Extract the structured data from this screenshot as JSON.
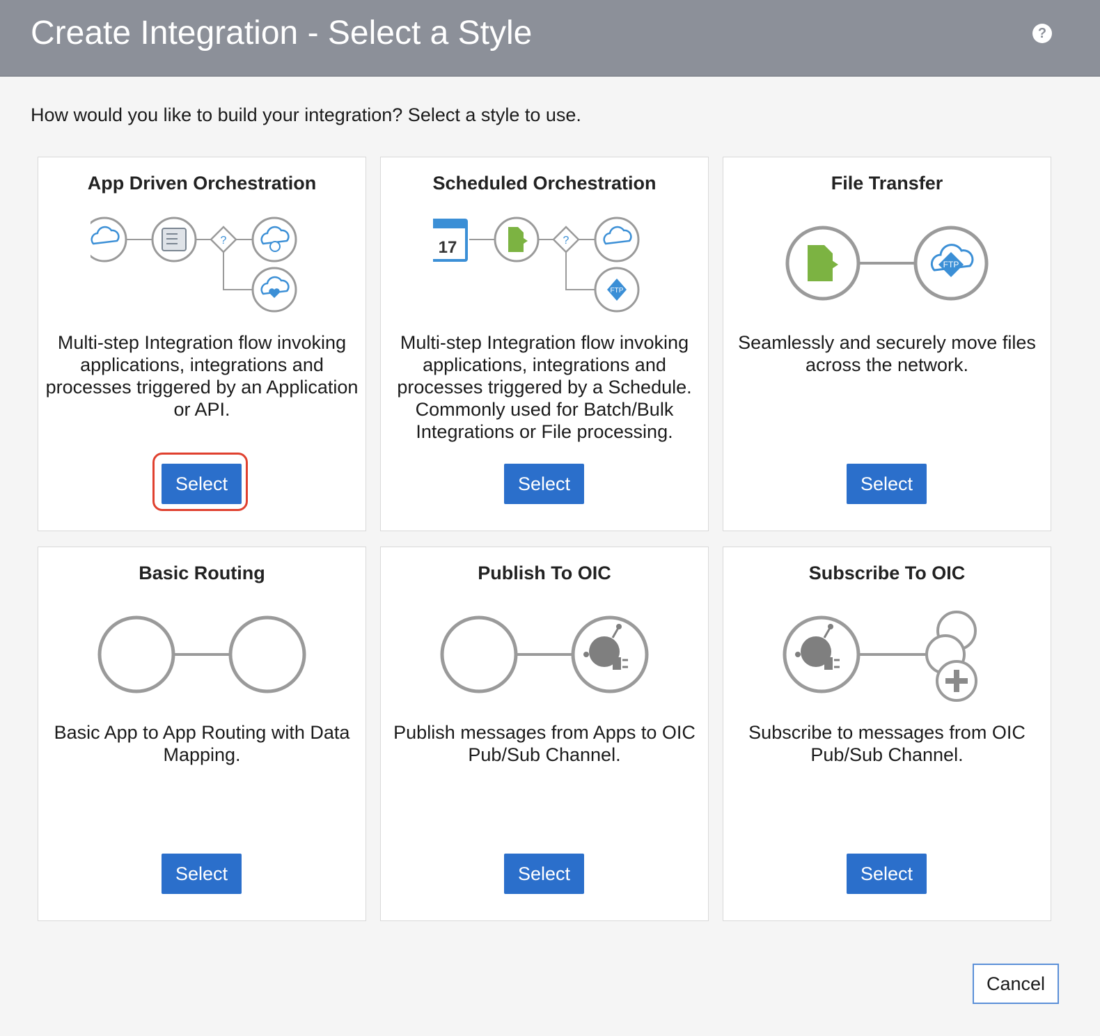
{
  "header": {
    "title": "Create Integration - Select a Style",
    "help_icon": "question-circle-icon"
  },
  "prompt": "How would you like to build your integration? Select a style to use.",
  "styles": [
    {
      "title": "App Driven Orchestration",
      "description": "Multi-step Integration flow invoking applications, integrations and processes triggered by an Application or API.",
      "select_label": "Select",
      "highlighted": true
    },
    {
      "title": "Scheduled Orchestration",
      "description": "Multi-step Integration flow invoking applications, integrations and processes triggered by a Schedule. Commonly used for Batch/Bulk Integrations or File processing.",
      "select_label": "Select",
      "calendar_day": "17"
    },
    {
      "title": "File Transfer",
      "description": "Seamlessly and securely move files across the network.",
      "select_label": "Select",
      "ftp_label": "FTP"
    },
    {
      "title": "Basic Routing",
      "description": "Basic App to App Routing with Data Mapping.",
      "select_label": "Select"
    },
    {
      "title": "Publish To OIC",
      "description": "Publish messages from Apps to OIC Pub/Sub Channel.",
      "select_label": "Select"
    },
    {
      "title": "Subscribe To OIC",
      "description": "Subscribe to messages from OIC Pub/Sub Channel.",
      "select_label": "Select"
    }
  ],
  "footer": {
    "cancel_label": "Cancel"
  },
  "colors": {
    "header_bg": "#8c9099",
    "primary_button": "#2b6fcb",
    "highlight": "#e0412f",
    "icon_blue": "#3b8fd6",
    "icon_green": "#7cb342"
  }
}
